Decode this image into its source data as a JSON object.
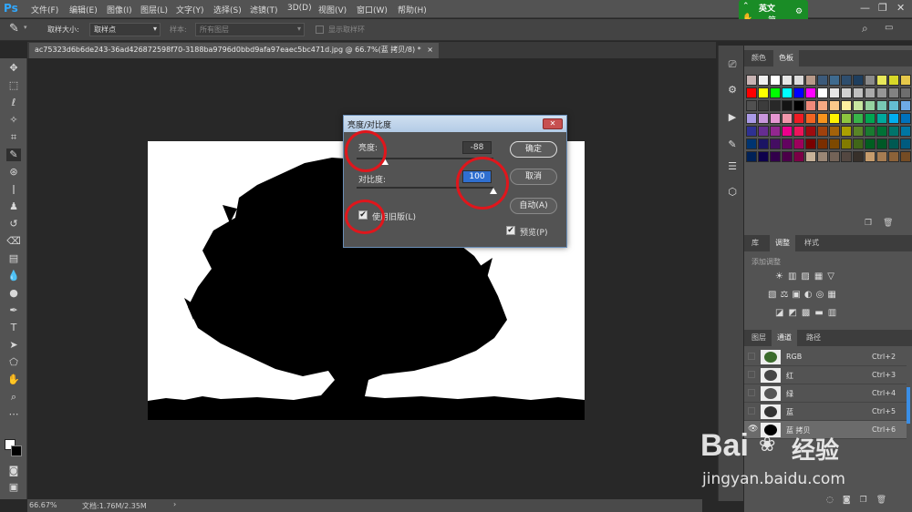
{
  "app": {
    "logo": "Ps"
  },
  "menu": [
    "文件(F)",
    "编辑(E)",
    "图像(I)",
    "图层(L)",
    "文字(Y)",
    "选择(S)",
    "滤镜(T)",
    "3D(D)",
    "视图(V)",
    "窗口(W)",
    "帮助(H)"
  ],
  "ime": {
    "lang": "英文",
    "mode": "简",
    "extra": "⚙"
  },
  "window_controls": [
    "—",
    "❐",
    "✕"
  ],
  "options_bar": {
    "sample_size_label": "取样大小:",
    "sample_size_value": "取样点",
    "sample_label": "样本:",
    "sample_value": "所有图层",
    "show_ring_label": "显示取样环"
  },
  "document_tab": {
    "title": "ac75323d6b6de243-36ad426872598f70-3188ba9796d0bbd9afa97eaec5bc471d.jpg @ 66.7%(蓝 拷贝/8) *",
    "close": "×"
  },
  "status": {
    "zoom": "66.67%",
    "doc": "文档:1.76M/2.35M",
    "arrow": "›"
  },
  "panels": {
    "color_tabs": [
      "颜色",
      "色板"
    ],
    "adjust_tabs": [
      "库",
      "调整",
      "样式"
    ],
    "adjust_add": "添加调整",
    "channel_tabs": [
      "图层",
      "通道",
      "路径"
    ],
    "channels": [
      {
        "name": "RGB",
        "key": "Ctrl+2"
      },
      {
        "name": "红",
        "key": "Ctrl+3"
      },
      {
        "name": "绿",
        "key": "Ctrl+4"
      },
      {
        "name": "蓝",
        "key": "Ctrl+5"
      },
      {
        "name": "蓝 拷贝",
        "key": "Ctrl+6"
      }
    ],
    "swatch_colors": [
      "#c8b4b4",
      "#f0f0f0",
      "#ffffff",
      "#e6e6e6",
      "#dcdcdc",
      "#b89a8a",
      "#3c5a7a",
      "#3e6a8e",
      "#2e4e6e",
      "#1e3e5e",
      "#8a8a8a",
      "#e8e85a",
      "#d8d828",
      "#e6c84a",
      "#f0d2c0",
      "#ff0000",
      "#ffff00",
      "#00ff00",
      "#00ffff",
      "#0000ff",
      "#ff00ff",
      "#ffffff",
      "#e6e6e6",
      "#d2d2d2",
      "#c0c0c0",
      "#aaaaaa",
      "#969696",
      "#828282",
      "#6e6e6e",
      "#5a5a5a",
      "#505050",
      "#3c3c3c",
      "#282828",
      "#141414",
      "#000000",
      "#f08a7a",
      "#f6a882",
      "#fcc88a",
      "#fff0a0",
      "#c8e6a0",
      "#96d2a0",
      "#78c8b4",
      "#64bed2",
      "#6eaae6",
      "#8caaf0",
      "#aa9ae6",
      "#c896dc",
      "#e696d2",
      "#f096aa",
      "#ee1c24",
      "#f26522",
      "#f7941d",
      "#fff200",
      "#8dc63f",
      "#39b54a",
      "#00a651",
      "#00a99d",
      "#00aeef",
      "#0072bc",
      "#0054a6",
      "#2e3192",
      "#662d91",
      "#92278f",
      "#ec008c",
      "#ed145b",
      "#9e0b0f",
      "#a0410d",
      "#a3620a",
      "#aba000",
      "#598527",
      "#197b30",
      "#007236",
      "#00746b",
      "#0076a3",
      "#004a80",
      "#003471",
      "#1b1464",
      "#440e62",
      "#630460",
      "#9e005d",
      "#790000",
      "#7b2e00",
      "#7d4900",
      "#827b00",
      "#406618",
      "#005e20",
      "#005826",
      "#005952",
      "#005b7f",
      "#003663",
      "#002157",
      "#0d004c",
      "#32004b",
      "#4b0049",
      "#7b0046",
      "#c7b299",
      "#998675",
      "#736357",
      "#534741",
      "#37302a",
      "#c69c6d",
      "#a67c52",
      "#8c6239",
      "#754c24",
      "#603913"
    ]
  },
  "dialog": {
    "title": "亮度/对比度",
    "close": "✕",
    "brightness_label": "亮度:",
    "brightness_value": "-88",
    "brightness_level": -88,
    "contrast_label": "对比度:",
    "contrast_value": "100",
    "contrast_level": 100,
    "ok": "确定",
    "cancel": "取消",
    "auto": "自动(A)",
    "use_legacy": "使用旧版(L)",
    "preview": "预览(P)",
    "check": "✔"
  },
  "watermark": {
    "brand": "Bai",
    "brand2": "经验",
    "url": "jingyan.baidu.com"
  }
}
